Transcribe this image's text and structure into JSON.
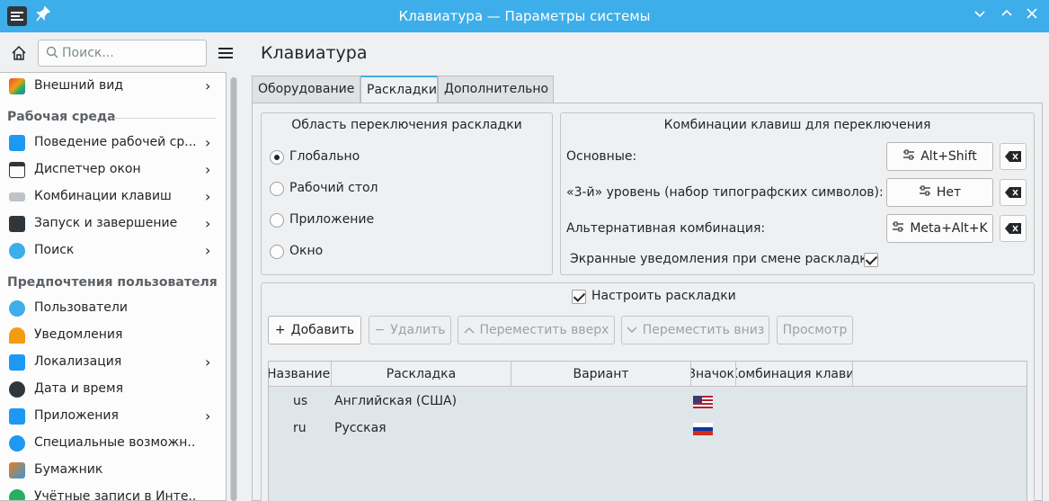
{
  "window": {
    "title": "Клавиатура — Параметры системы"
  },
  "sidebar": {
    "search_placeholder": "Поиск...",
    "top_item": {
      "label": "Внешний вид",
      "icon": "appearance-icon"
    },
    "sections": [
      {
        "title": "Рабочая среда",
        "items": [
          {
            "label": "Поведение рабочей ср...",
            "icon": "workspace-behavior-icon",
            "has_children": true
          },
          {
            "label": "Диспетчер окон",
            "icon": "window-manager-icon",
            "has_children": true
          },
          {
            "label": "Комбинации клавиш",
            "icon": "shortcuts-icon",
            "has_children": true
          },
          {
            "label": "Запуск и завершение",
            "icon": "startup-shutdown-icon",
            "has_children": true
          },
          {
            "label": "Поиск",
            "icon": "search-icon",
            "has_children": true
          }
        ]
      },
      {
        "title": "Предпочтения пользователя",
        "items": [
          {
            "label": "Пользователи",
            "icon": "users-icon",
            "has_children": false
          },
          {
            "label": "Уведомления",
            "icon": "bell-icon",
            "has_children": false
          },
          {
            "label": "Локализация",
            "icon": "localization-icon",
            "has_children": true
          },
          {
            "label": "Дата и время",
            "icon": "clock-icon",
            "has_children": false
          },
          {
            "label": "Приложения",
            "icon": "applications-icon",
            "has_children": true
          },
          {
            "label": "Специальные возможн...",
            "icon": "accessibility-icon",
            "has_children": false
          },
          {
            "label": "Бумажник",
            "icon": "wallet-icon",
            "has_children": false
          },
          {
            "label": "Учётные записи в Инте...",
            "icon": "online-accounts-icon",
            "has_children": false
          }
        ]
      }
    ]
  },
  "main": {
    "title": "Клавиатура",
    "tabs": [
      {
        "label": "Оборудование",
        "active": false
      },
      {
        "label": "Раскладки",
        "active": true
      },
      {
        "label": "Дополнительно",
        "active": false
      }
    ],
    "switch_scope": {
      "title": "Область переключения раскладки",
      "options": [
        {
          "label": "Глобально",
          "selected": true
        },
        {
          "label": "Рабочий стол",
          "selected": false
        },
        {
          "label": "Приложение",
          "selected": false
        },
        {
          "label": "Окно",
          "selected": false
        }
      ]
    },
    "shortcuts": {
      "title": "Комбинации клавиш для переключения",
      "rows": [
        {
          "label": "Основные:",
          "value": "Alt+Shift"
        },
        {
          "label": "«3-й» уровень (набор типографских символов):",
          "value": "Нет"
        },
        {
          "label": "Альтернативная комбинация:",
          "value": "Meta+Alt+K"
        }
      ],
      "osd_label": "Экранные уведомления при смене раскладки",
      "osd_checked": true
    },
    "layouts": {
      "configure_label": "Настроить раскладки",
      "configure_checked": true,
      "buttons": [
        {
          "label": "Добавить",
          "glyph": "+",
          "enabled": true
        },
        {
          "label": "Удалить",
          "glyph": "−",
          "enabled": false
        },
        {
          "label": "Переместить вверх",
          "glyph": "^",
          "enabled": false
        },
        {
          "label": "Переместить вниз",
          "glyph": "v",
          "enabled": false
        },
        {
          "label": "Просмотр",
          "glyph": "",
          "enabled": false
        }
      ],
      "columns": [
        "Название",
        "Раскладка",
        "Вариант",
        "Значок",
        "Комбинация клавиш"
      ],
      "rows": [
        {
          "name": "us",
          "layout": "Английская (США)",
          "variant": "",
          "flag": "us-flag-icon"
        },
        {
          "name": "ru",
          "layout": "Русская",
          "variant": "",
          "flag": "ru-flag-icon"
        }
      ]
    }
  }
}
